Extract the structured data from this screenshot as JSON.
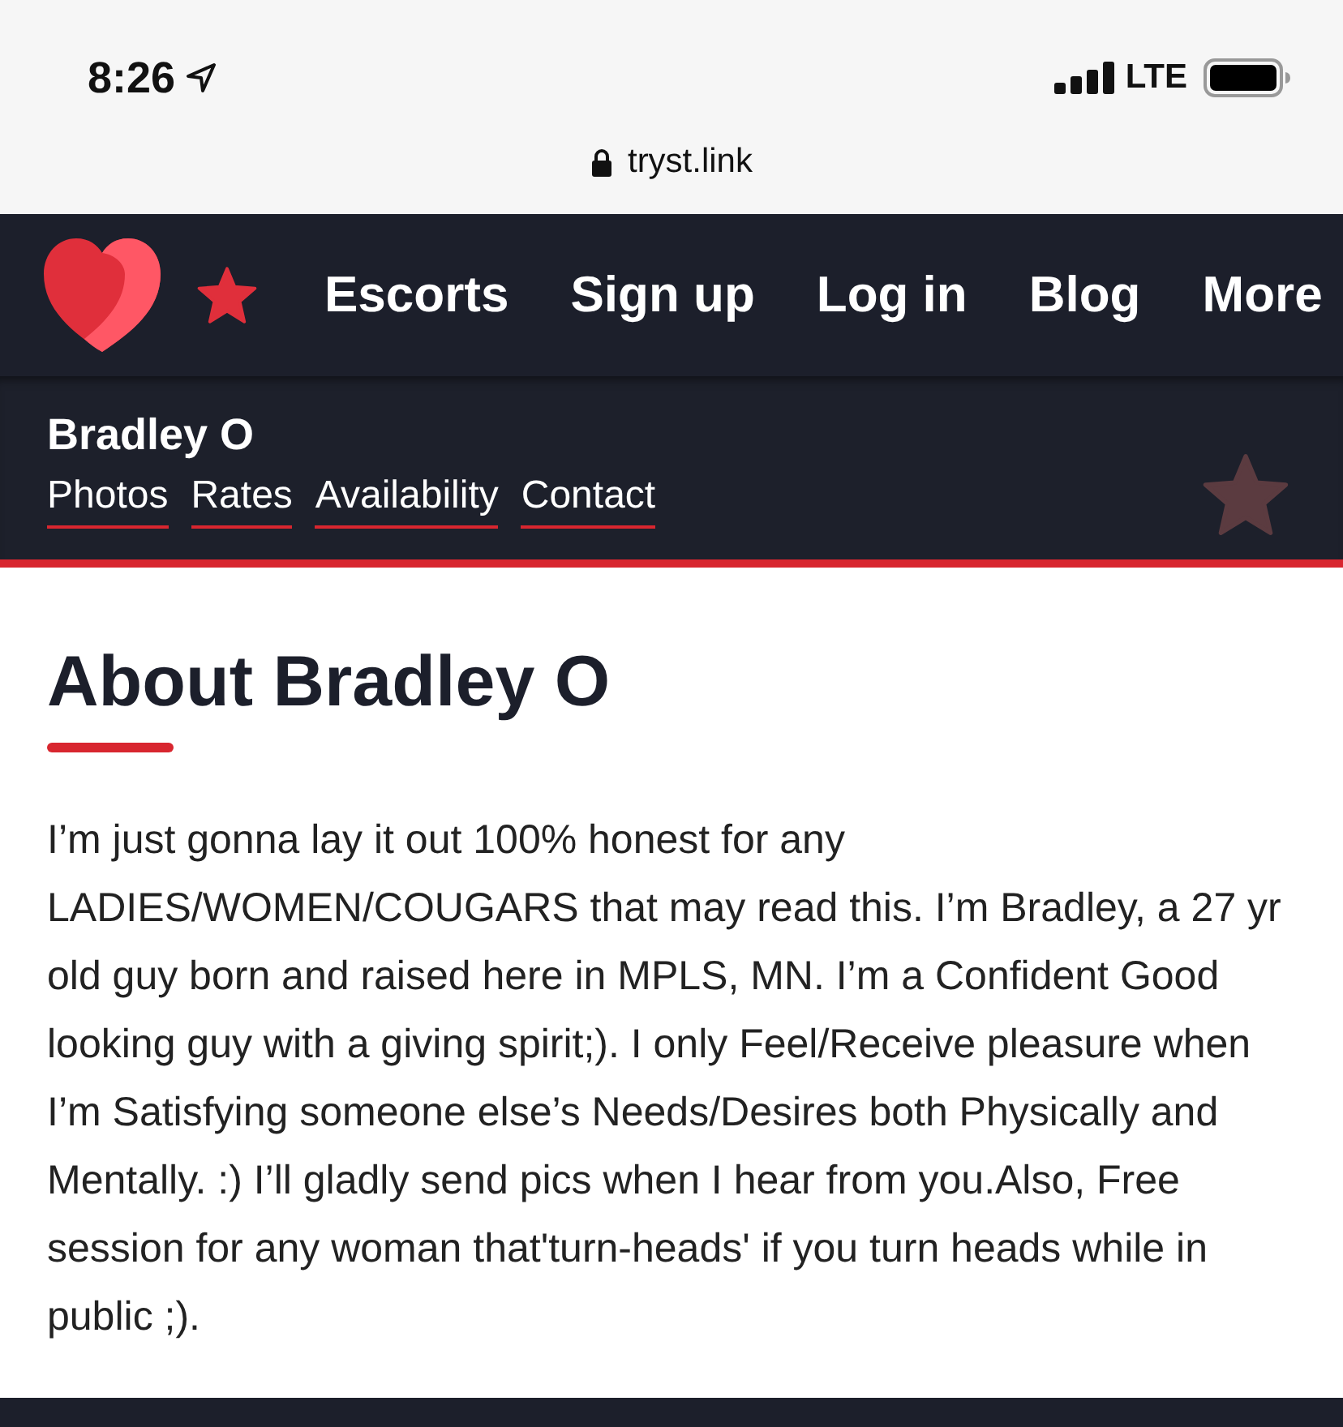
{
  "status_bar": {
    "time": "8:26",
    "network": "LTE"
  },
  "address_bar": {
    "url": "tryst.link"
  },
  "nav": {
    "items": [
      "Escorts",
      "Sign up",
      "Log in",
      "Blog",
      "More"
    ]
  },
  "profile_bar": {
    "name": "Bradley O",
    "tabs": [
      "Photos",
      "Rates",
      "Availability",
      "Contact"
    ]
  },
  "about": {
    "title": "About Bradley O",
    "body": "I’m just gonna lay it out 100% honest for any LADIES/WOMEN/COUGARS that may read this. I’m Bradley, a 27 yr old guy born and raised here in MPLS, MN. I’m a Confident Good looking guy with a giving spirit;). I only Feel/Receive pleasure when I’m Satisfying someone else’s Needs/Desires both Physically and Mentally. :) I’ll gladly send pics when I hear from you.Also, Free session for any woman that'turn-heads' if you turn heads while in public ;)."
  }
}
